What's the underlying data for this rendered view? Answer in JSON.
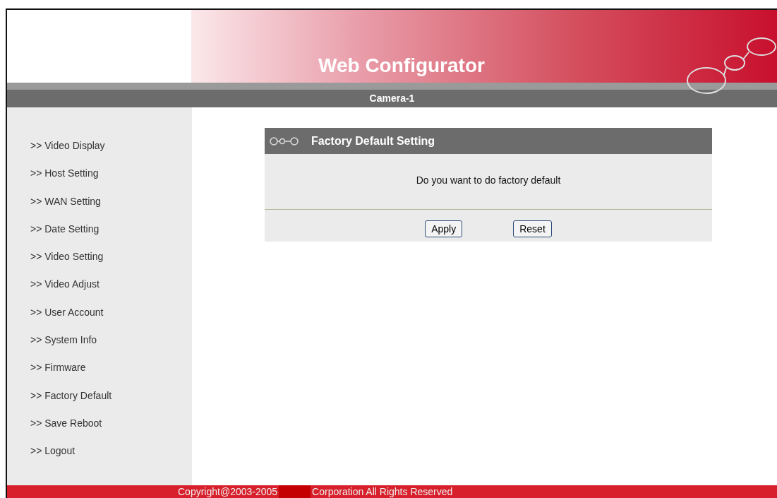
{
  "header": {
    "title": "Web Configurator"
  },
  "device_bar": {
    "name": "Camera-1"
  },
  "sidebar": {
    "items": [
      {
        "label": ">> Video Display"
      },
      {
        "label": ">> Host Setting"
      },
      {
        "label": ">> WAN Setting"
      },
      {
        "label": ">> Date Setting"
      },
      {
        "label": ">> Video Setting"
      },
      {
        "label": ">> Video Adjust"
      },
      {
        "label": ">> User Account"
      },
      {
        "label": ">> System Info"
      },
      {
        "label": ">> Firmware"
      },
      {
        "label": ">> Factory Default"
      },
      {
        "label": ">> Save Reboot"
      },
      {
        "label": ">> Logout"
      }
    ]
  },
  "panel": {
    "title": "Factory Default Setting",
    "message": "Do you want to do factory default",
    "buttons": [
      "Apply",
      "Reset"
    ]
  },
  "footer": {
    "left": "Copyright@2003-2005",
    "right": "Corporation All Rights Reserved"
  }
}
